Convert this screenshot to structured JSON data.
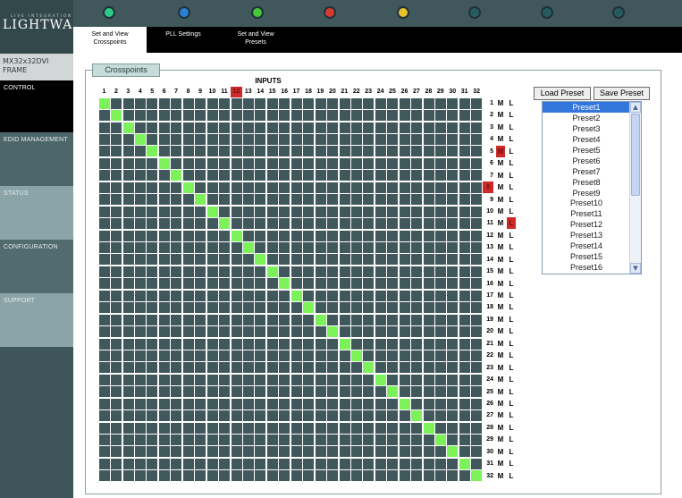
{
  "brand": {
    "sub": "LIVE INTEGRATION",
    "name": "LIGHTWARE"
  },
  "device": {
    "line1": "MX32x32DVI",
    "line2": "FRAME"
  },
  "sidebar": {
    "items": [
      {
        "label": "CONTROL"
      },
      {
        "label": "EDID MANAGEMENT"
      },
      {
        "label": "STATUS"
      },
      {
        "label": "CONFIGURATION"
      },
      {
        "label": "SUPPORT"
      }
    ]
  },
  "status_leds": [
    {
      "name": "led-1",
      "color": "#2ec88a"
    },
    {
      "name": "led-2",
      "color": "#2b7fd4"
    },
    {
      "name": "led-3",
      "color": "#46c83a"
    },
    {
      "name": "led-4",
      "color": "#d83a2e"
    },
    {
      "name": "led-5",
      "color": "#e6c22e"
    },
    {
      "name": "led-6",
      "color": "#275c5f"
    },
    {
      "name": "led-7",
      "color": "#275c5f"
    },
    {
      "name": "led-8",
      "color": "#275c5f"
    }
  ],
  "tabs": [
    {
      "line1": "Set and View",
      "line2": "Crosspoints"
    },
    {
      "line1": "PLL Settings",
      "line2": ""
    },
    {
      "line1": "Set and View",
      "line2": "Presets"
    }
  ],
  "crosspoints": {
    "title": "Crosspoints",
    "inputs_label": "INPUTS",
    "mute_label": "M",
    "lock_label": "L",
    "inputs": [
      "1",
      "2",
      "3",
      "4",
      "5",
      "6",
      "7",
      "8",
      "9",
      "10",
      "11",
      "12",
      "13",
      "14",
      "15",
      "16",
      "17",
      "18",
      "19",
      "20",
      "21",
      "22",
      "23",
      "24",
      "25",
      "26",
      "27",
      "28",
      "29",
      "30",
      "31",
      "32"
    ],
    "outputs": [
      "1",
      "2",
      "3",
      "4",
      "5",
      "6",
      "7",
      "8",
      "9",
      "10",
      "11",
      "12",
      "13",
      "14",
      "15",
      "16",
      "17",
      "18",
      "19",
      "20",
      "21",
      "22",
      "23",
      "24",
      "25",
      "26",
      "27",
      "28",
      "29",
      "30",
      "31",
      "32"
    ],
    "highlighted_inputs": [
      12
    ],
    "highlighted_outputs": [
      8
    ],
    "muted_outputs": [
      5
    ],
    "locked_outputs": [
      11
    ],
    "connections": [
      1,
      2,
      3,
      4,
      5,
      6,
      7,
      8,
      9,
      10,
      11,
      12,
      13,
      14,
      15,
      16,
      17,
      18,
      19,
      20,
      21,
      22,
      23,
      24,
      25,
      26,
      27,
      28,
      29,
      30,
      31,
      32
    ],
    "colors": {
      "cell_off": "#40585b",
      "cell_on": "#7cf15a",
      "highlight": "#cc2a2a"
    }
  },
  "presets": {
    "load_label": "Load Preset",
    "save_label": "Save Preset",
    "selected": "Preset1",
    "items": [
      "Preset1",
      "Preset2",
      "Preset3",
      "Preset4",
      "Preset5",
      "Preset6",
      "Preset7",
      "Preset8",
      "Preset9",
      "Preset10",
      "Preset11",
      "Preset12",
      "Preset13",
      "Preset14",
      "Preset15",
      "Preset16"
    ]
  }
}
